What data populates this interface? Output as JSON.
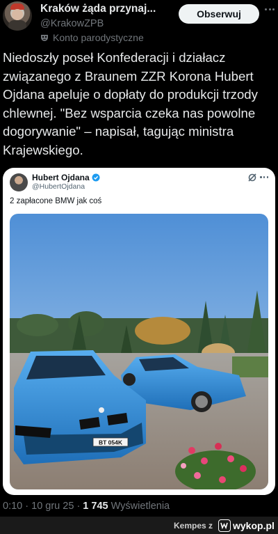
{
  "author": {
    "name": "Kraków żąda przynaj...",
    "handle": "@KrakowZPB",
    "label": "Konto parodystyczne",
    "follow_label": "Obserwuj"
  },
  "post": {
    "text": "Niedoszły poseł Konfederacji i działacz związanego z Braunem ZZR Korona Hubert Ojdana apeluje o dopłaty  do produkcji trzody chlewnej. \"Bez wsparcia czeka nas powolne dogorywanie\" – napisał, tagując ministra Krajewskiego."
  },
  "quoted": {
    "name": "Hubert Ojdana",
    "handle": "@HubertOjdana",
    "text": "2 zapłacone BMW jak coś",
    "plate": "BT 054K"
  },
  "meta": {
    "time": "0:10",
    "date": "10 gru 25",
    "views": "1 745",
    "views_label": "Wyświetlenia"
  },
  "footer": {
    "credit": "Kempes  z",
    "site": "wykop.pl"
  },
  "colors": {
    "background": "#000000",
    "follow_bg": "#eff3f4",
    "verified": "#1d9bf0",
    "car_blue": "#2f8fd8"
  },
  "icons": [
    "parody-mask-icon",
    "more-icon",
    "verified-badge-icon",
    "grok-icon",
    "wykop-logo-icon"
  ]
}
